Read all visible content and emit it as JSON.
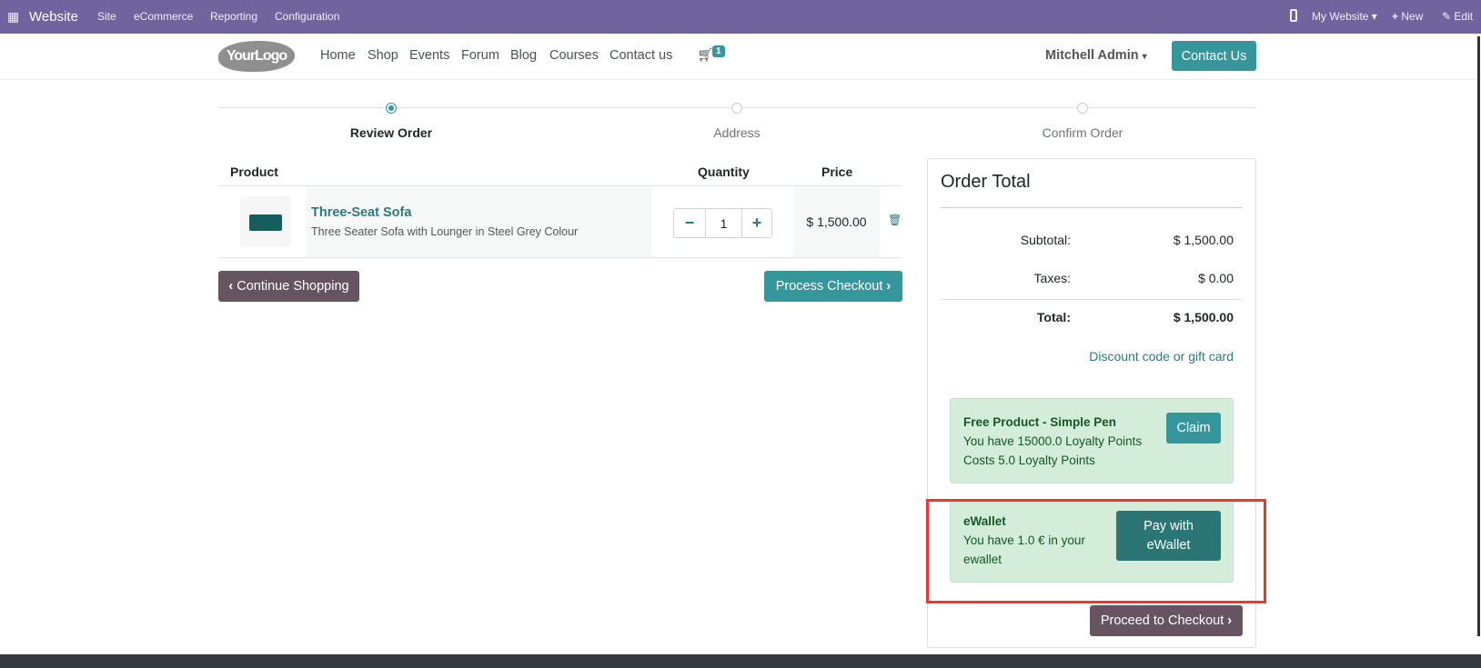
{
  "topbar": {
    "app": "Website",
    "menu": [
      "Site",
      "eCommerce",
      "Reporting",
      "Configuration"
    ],
    "website": "My Website",
    "new": "New",
    "edit": "Edit"
  },
  "header": {
    "logo": "YourLogo",
    "nav": [
      "Home",
      "Shop",
      "Events",
      "Forum",
      "Blog",
      "Courses",
      "Contact us"
    ],
    "cart_count": "1",
    "user": "Mitchell Admin",
    "contact_btn": "Contact Us"
  },
  "steps": [
    {
      "label": "Review Order",
      "active": true
    },
    {
      "label": "Address",
      "active": false
    },
    {
      "label": "Confirm Order",
      "active": false
    }
  ],
  "table": {
    "headers": [
      "Product",
      "Quantity",
      "Price"
    ],
    "rows": [
      {
        "name": "Three-Seat Sofa",
        "desc": "Three Seater Sofa with Lounger in Steel Grey Colour",
        "qty": "1",
        "price": "$ 1,500.00"
      }
    ]
  },
  "buttons": {
    "continue": "Continue Shopping",
    "process": "Process Checkout",
    "proceed": "Proceed to Checkout"
  },
  "order_total": {
    "title": "Order Total",
    "subtotal_label": "Subtotal:",
    "subtotal": "$ 1,500.00",
    "taxes_label": "Taxes:",
    "taxes": "$ 0.00",
    "total_label": "Total:",
    "total": "$ 1,500.00",
    "discount_link": "Discount code or gift card"
  },
  "reward": {
    "title": "Free Product - Simple Pen",
    "line1": "You have 15000.0 Loyalty Points",
    "line2": "Costs 5.0 Loyalty Points",
    "button": "Claim"
  },
  "ewallet": {
    "title": "eWallet",
    "text": "You have 1.0 € in your ewallet",
    "button": "Pay with eWallet"
  },
  "colors": {
    "topbar": "#71639e",
    "primary": "#35979c",
    "secondary": "#665561",
    "highlight": "#e53935"
  }
}
